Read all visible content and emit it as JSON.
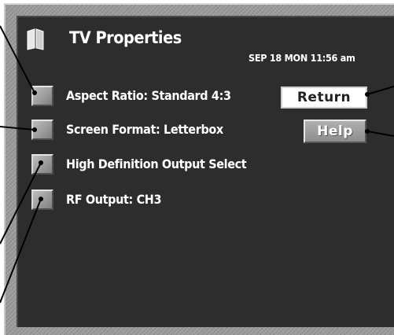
{
  "header": {
    "title": "TV Properties",
    "datetime": "SEP 18 MON  11:56 am",
    "icon": "book-icon"
  },
  "menu": {
    "items": [
      {
        "label": "Aspect Ratio:  Standard 4:3"
      },
      {
        "label": "Screen Format:  Letterbox"
      },
      {
        "label": "High Definition Output Select"
      },
      {
        "label": "RF Output:  CH3"
      }
    ]
  },
  "buttons": {
    "return_label": "Return",
    "help_label": "Help"
  },
  "colors": {
    "screen_bg": "#2d2d2d",
    "bezel": "#9a9a9a",
    "text": "#ffffff"
  }
}
